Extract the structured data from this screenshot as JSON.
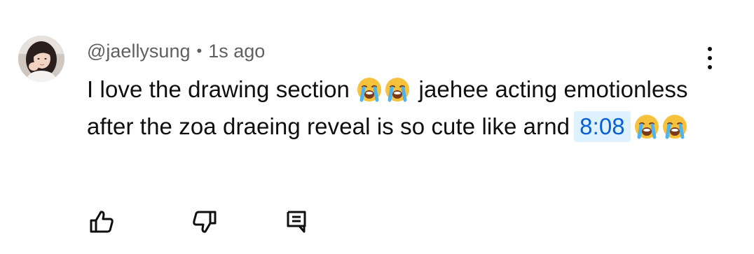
{
  "comment": {
    "author": "@jaellysung",
    "separator": "•",
    "time": "1s ago",
    "text_part1": "I love the drawing section",
    "text_part2": "jaehee acting emotionless after the zoa draeing reveal is so cute like arnd",
    "timestamp_link": "8:08",
    "emoji": "loudly-crying-face"
  },
  "actions": {
    "like_icon": "thumbs-up-icon",
    "dislike_icon": "thumbs-down-icon",
    "reply_icon": "comment-reply-icon",
    "menu_icon": "more-vertical-icon"
  },
  "colors": {
    "link": "#065fd4",
    "link_bg": "#def1ff",
    "secondary_text": "#606060",
    "primary_text": "#0f0f0f"
  }
}
